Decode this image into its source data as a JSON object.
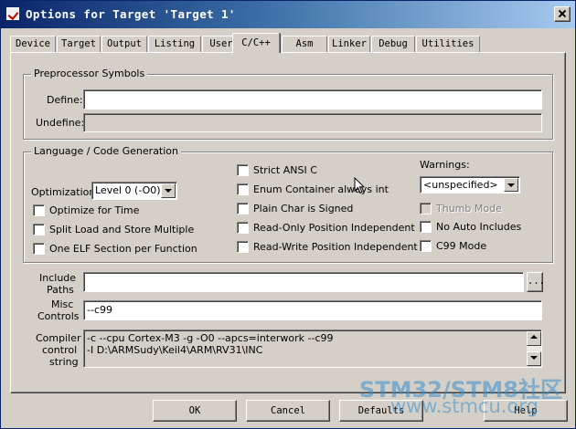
{
  "window": {
    "title": "Options for Target 'Target 1'"
  },
  "tabs": [
    {
      "label": "Device"
    },
    {
      "label": "Target"
    },
    {
      "label": "Output"
    },
    {
      "label": "Listing"
    },
    {
      "label": "User"
    },
    {
      "label": "C/C++"
    },
    {
      "label": "Asm"
    },
    {
      "label": "Linker"
    },
    {
      "label": "Debug"
    },
    {
      "label": "Utilities"
    }
  ],
  "preprocessor": {
    "group_label": "Preprocessor Symbols",
    "define_label": "Define:",
    "define_value": "",
    "undefine_label": "Undefine:",
    "undefine_value": ""
  },
  "language": {
    "group_label": "Language / Code Generation",
    "optimization_label": "Optimization:",
    "optimization_value": "Level 0 (-O0)",
    "checks": {
      "optimize_for_time": "Optimize for Time",
      "split_load_store": "Split Load and Store Multiple",
      "one_elf_section": "One ELF Section per Function",
      "strict_ansi": "Strict ANSI C",
      "enum_container": "Enum Container always int",
      "plain_char_signed": "Plain Char is Signed",
      "read_only_pos_indep": "Read-Only Position Independent",
      "read_write_pos_indep": "Read-Write Position Independent",
      "thumb_mode": "Thumb Mode",
      "no_auto_includes": "No Auto Includes",
      "c99_mode": "C99 Mode"
    },
    "warnings_label": "Warnings:",
    "warnings_value": "<unspecified>"
  },
  "include": {
    "label_line1": "Include",
    "label_line2": "Paths",
    "value": "",
    "browse_label": "..."
  },
  "misc": {
    "label_line1": "Misc",
    "label_line2": "Controls",
    "value": "--c99"
  },
  "compiler": {
    "label_line1": "Compiler",
    "label_line2": "control",
    "label_line3": "string",
    "line1": "-c --cpu Cortex-M3 -g -O0 --apcs=interwork --c99",
    "line2": "-I D:\\ARMSudy\\Keil4\\ARM\\RV31\\INC"
  },
  "buttons": {
    "ok": "OK",
    "cancel": "Cancel",
    "defaults": "Defaults",
    "help": "Help"
  },
  "watermark": {
    "line1": "STM32/STM8社区",
    "line2": "www.stmcu.org"
  },
  "colors": {
    "titlebar_start": "#0a246a",
    "titlebar_end": "#a6caf0",
    "face": "#d4d0c8",
    "watermark": "#3a8fcf"
  }
}
